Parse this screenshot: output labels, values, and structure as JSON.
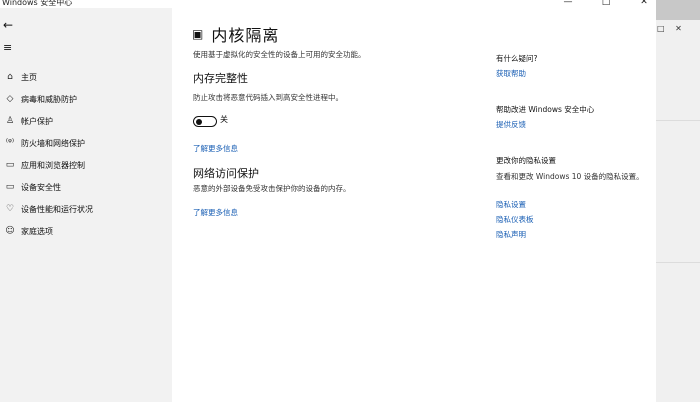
{
  "window": {
    "title": "Windows 安全中心",
    "controls": [
      "—",
      "□",
      "✕"
    ]
  },
  "sidebar": {
    "back_icon": "back-arrow-icon",
    "menu_icon": "hamburger-icon",
    "items": [
      {
        "label": "主页",
        "icon": "home-icon"
      },
      {
        "label": "病毒和威胁防护",
        "icon": "shield-icon"
      },
      {
        "label": "帐户保护",
        "icon": "person-icon"
      },
      {
        "label": "防火墙和网络保护",
        "icon": "antenna-icon"
      },
      {
        "label": "应用和浏览器控制",
        "icon": "browser-window-icon"
      },
      {
        "label": "设备安全性",
        "icon": "laptop-icon"
      },
      {
        "label": "设备性能和运行状况",
        "icon": "heart-icon"
      },
      {
        "label": "家庭选项",
        "icon": "family-icon"
      }
    ]
  },
  "main": {
    "title": "内核隔离",
    "title_icon": "core-isolation-icon",
    "description": "使用基于虚拟化的安全性的设备上可用的安全功能。",
    "memory_integrity": {
      "title": "内存完整性",
      "description": "防止攻击将恶意代码插入到高安全性进程中。",
      "toggle_state": "关",
      "learn_more": "了解更多信息"
    },
    "network_protection": {
      "title": "网络访问保护",
      "description": "恶意的外部设备免受攻击保护你的设备的内存。",
      "learn_more": "了解更多信息"
    }
  },
  "right_panel": {
    "help": {
      "heading": "有什么疑问?",
      "link": "获取帮助"
    },
    "improve": {
      "heading": "帮助改进 Windows 安全中心",
      "link": "提供反馈"
    },
    "privacy": {
      "heading": "更改你的隐私设置",
      "text": "查看和更改 Windows 10 设备的隐私设置。",
      "links": [
        "隐私设置",
        "隐私仪表板",
        "隐私声明"
      ]
    }
  },
  "colors": {
    "link": "#1a5fb4",
    "sidebar_bg": "#f2f2f2",
    "content_bg": "#ffffff"
  }
}
